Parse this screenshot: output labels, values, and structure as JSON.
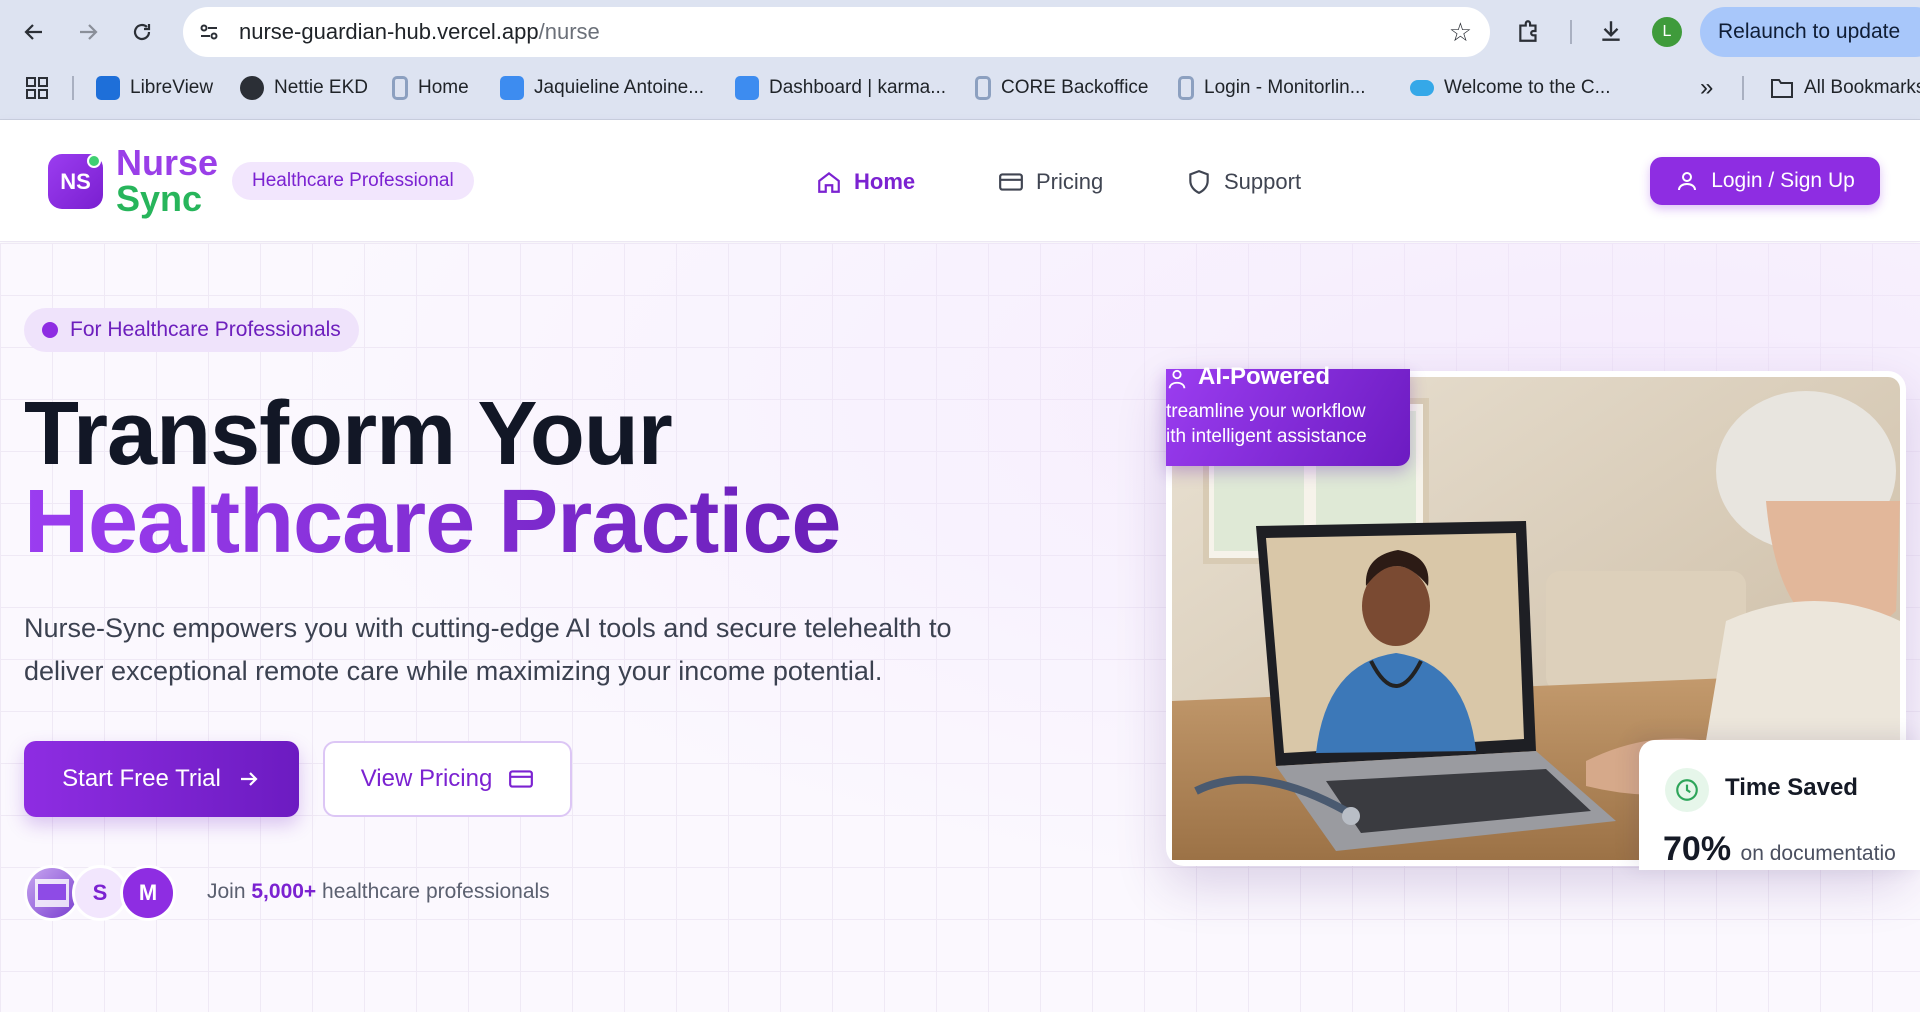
{
  "browser": {
    "url_host": "nurse-guardian-hub.vercel.app",
    "url_path": "/nurse",
    "profile_initial": "L",
    "relaunch_label": "Relaunch to update",
    "bookmarks": [
      {
        "label": "LibreView",
        "color": "#1e6fd9"
      },
      {
        "label": "Nettie EKD",
        "color": "#2b2f36"
      },
      {
        "label": "Home",
        "color": "#8ca0c0"
      },
      {
        "label": "Jaquieline Antoine...",
        "color": "#3d8cf0"
      },
      {
        "label": "Dashboard | karma...",
        "color": "#3d8cf0"
      },
      {
        "label": "CORE Backoffice",
        "color": "#8ca0c0"
      },
      {
        "label": "Login - Monitorlin...",
        "color": "#8ca0c0"
      },
      {
        "label": "Welcome to the C...",
        "color": "#35a8e8"
      }
    ],
    "all_bookmarks_label": "All Bookmarks"
  },
  "header": {
    "logo_initials": "NS",
    "brand_line1": "Nurse",
    "brand_line2": "Sync",
    "badge": "Healthcare Professional",
    "nav": [
      {
        "label": "Home",
        "icon": "home-icon",
        "active": true
      },
      {
        "label": "Pricing",
        "icon": "credit-card-icon",
        "active": false
      },
      {
        "label": "Support",
        "icon": "shield-icon",
        "active": false
      }
    ],
    "login_label": "Login / Sign Up"
  },
  "hero": {
    "pill": "For Healthcare Professionals",
    "title_line1": "Transform Your",
    "title_line2": "Healthcare Practice",
    "lead": "Nurse-Sync empowers you with cutting-edge AI tools and secure telehealth to deliver exceptional remote care while maximizing your income potential.",
    "cta_primary": "Start Free Trial",
    "cta_secondary": "View Pricing",
    "avatars": [
      "S",
      "M"
    ],
    "join_prefix": "Join",
    "join_count": "5,000+",
    "join_suffix": "healthcare professionals"
  },
  "ai_badge": {
    "title": "AI-Powered",
    "line1": "treamline your workflow",
    "line2": "ith intelligent assistance"
  },
  "time_saved": {
    "title": "Time Saved",
    "value": "70%",
    "caption": "on documentatio"
  },
  "colors": {
    "accent": "#8e2de2",
    "accent_dark": "#6c1bc1",
    "green": "#27b55b"
  }
}
